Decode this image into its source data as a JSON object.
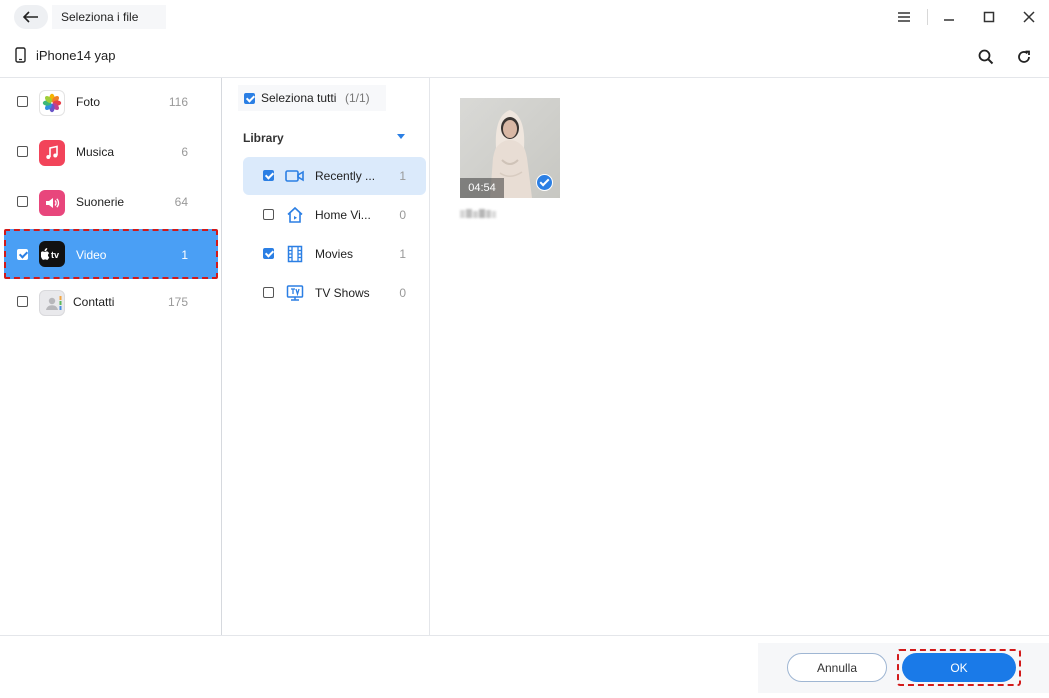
{
  "titlebar": {
    "title": "Seleziona i file",
    "icons": {
      "back": "arrow-left-icon",
      "menu": "hamburger-menu-icon",
      "minimize": "minimize-icon",
      "maximize": "maximize-icon",
      "close": "close-icon"
    }
  },
  "device": {
    "name": "iPhone14 yap",
    "icon": "phone-icon",
    "tools": [
      "search-icon",
      "refresh-icon"
    ]
  },
  "categories": [
    {
      "label": "Foto",
      "count": "116",
      "checked": false,
      "icon": "photos-app-icon"
    },
    {
      "label": "Musica",
      "count": "6",
      "checked": false,
      "icon": "music-app-icon"
    },
    {
      "label": "Suonerie",
      "count": "64",
      "checked": false,
      "icon": "ringtones-app-icon"
    },
    {
      "label": "Video",
      "count": "1",
      "checked": true,
      "icon": "apple-tv-app-icon"
    },
    {
      "label": "Contatti",
      "count": "175",
      "checked": false,
      "icon": "contacts-app-icon"
    }
  ],
  "select_all": {
    "label": "Seleziona tutti",
    "count": "(1/1)",
    "checked": true
  },
  "library": {
    "header": "Library",
    "items": [
      {
        "label": "Recently ...",
        "count": "1",
        "checked": true,
        "icon": "video-camera-icon"
      },
      {
        "label": "Home Vi...",
        "count": "0",
        "checked": false,
        "icon": "home-icon"
      },
      {
        "label": "Movies",
        "count": "1",
        "checked": true,
        "icon": "film-strip-icon"
      },
      {
        "label": "TV Shows",
        "count": "0",
        "checked": false,
        "icon": "tv-icon"
      }
    ]
  },
  "media": [
    {
      "duration": "04:54",
      "selected": true
    }
  ],
  "footer": {
    "cancel_label": "Annulla",
    "ok_label": "OK"
  },
  "colors": {
    "accent": "#2b7fe4",
    "active_category": "#4a9ff5",
    "highlight": "#d21a1a",
    "ok_button": "#1a7ae8"
  }
}
